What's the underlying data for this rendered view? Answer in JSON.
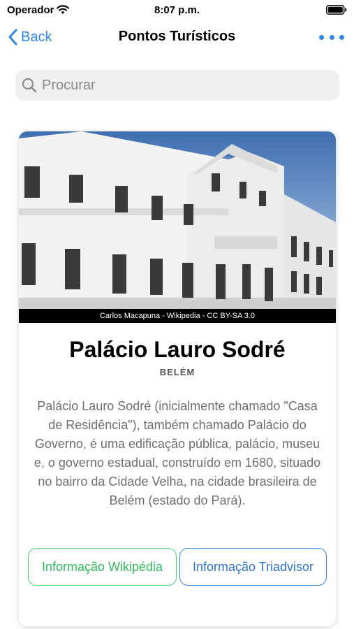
{
  "status": {
    "carrier": "Operador",
    "time": "8:07 p.m."
  },
  "nav": {
    "back_label": "Back",
    "title": "Pontos Turísticos"
  },
  "search": {
    "placeholder": "Procurar"
  },
  "card": {
    "image_credit": "Carlos Macapuna - Wikipedia - CC BY-SA 3.0",
    "title": "Palácio Lauro Sodré",
    "city": "BELÉM",
    "description": "Palácio Lauro Sodré (inicialmente chamado \"Casa de Residência\"), também chamado Palácio do Governo, é uma edificação pública, palácio, museu e, o governo estadual, construído em 1680, situado no bairro da Cidade Velha, na cidade brasileira de Belém (estado do Pará).",
    "wiki_button": "Informação Wikipédia",
    "trip_button": "Informação Triadvisor"
  },
  "colors": {
    "accent_blue": "#2f86e8",
    "wiki_green": "#3fd66f"
  }
}
